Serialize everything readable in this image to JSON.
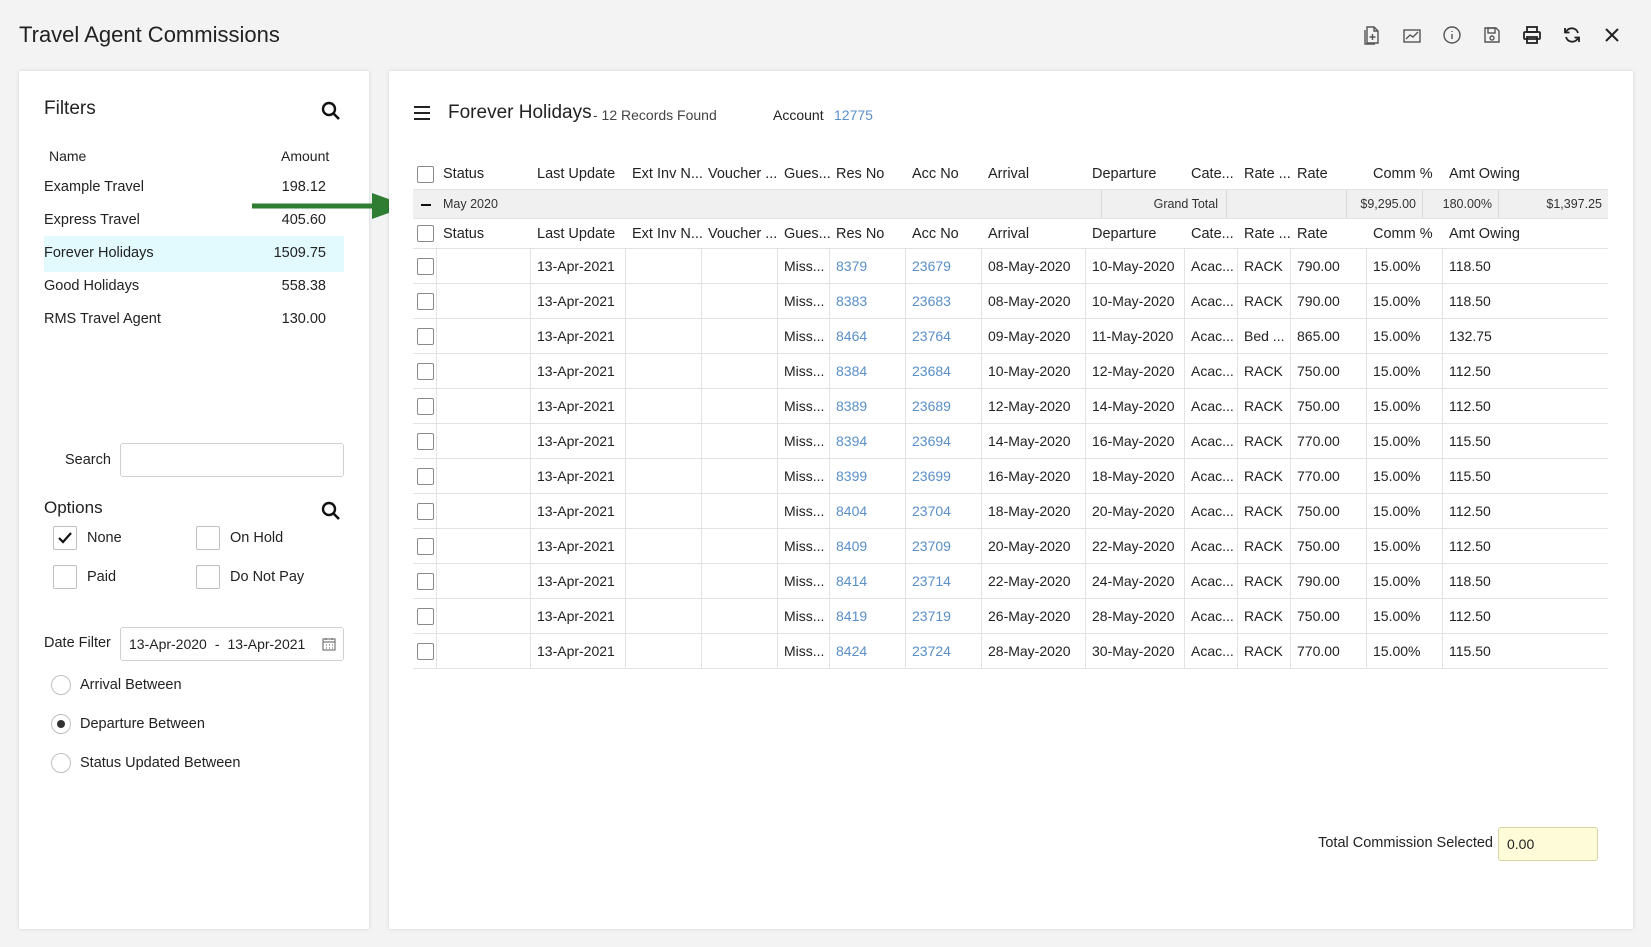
{
  "app": {
    "title": "Travel Agent Commissions"
  },
  "toolbar": {
    "icons": [
      "add-document-icon",
      "edit-chart-icon",
      "info-icon",
      "save-icon",
      "print-icon",
      "refresh-icon",
      "close-icon"
    ]
  },
  "filters": {
    "heading": "Filters",
    "col_name": "Name",
    "col_amount": "Amount",
    "agents": [
      {
        "name": "Example Travel",
        "amount": "198.12",
        "selected": false
      },
      {
        "name": "Express Travel",
        "amount": "405.60",
        "selected": false
      },
      {
        "name": "Forever Holidays",
        "amount": "1509.75",
        "selected": true
      },
      {
        "name": "Good Holidays",
        "amount": "558.38",
        "selected": false
      },
      {
        "name": "RMS Travel Agent",
        "amount": "130.00",
        "selected": false
      }
    ],
    "search_label": "Search",
    "search_value": "",
    "options_heading": "Options",
    "opt_none": "None",
    "opt_on_hold": "On Hold",
    "opt_paid": "Paid",
    "opt_do_not_pay": "Do Not Pay",
    "opt_none_checked": true,
    "date_filter_label": "Date Filter",
    "date_from": "13-Apr-2020",
    "date_sep": "-",
    "date_to": "13-Apr-2021",
    "radio_arrival": "Arrival Between",
    "radio_departure": "Departure Between",
    "radio_status": "Status Updated Between",
    "radio_selected": "departure"
  },
  "main": {
    "agency": "Forever Holidays",
    "records": "- 12 Records Found",
    "account_label": "Account",
    "account_value": "12775",
    "columns": [
      "Status",
      "Last Update",
      "Ext Inv N...",
      "Voucher ...",
      "Gues...",
      "Res No",
      "Acc No",
      "Arrival",
      "Departure",
      "Cate...",
      "Rate ...",
      "Rate",
      "Comm %",
      "Amt Owing"
    ],
    "group": {
      "label": "May 2020",
      "total_label": "Grand Total",
      "rate_total": "$9,295.00",
      "comm_total": "180.00%",
      "owing_total": "$1,397.25"
    },
    "rows": [
      {
        "status": "",
        "last_update": "13-Apr-2021",
        "ext_inv": "",
        "voucher": "",
        "guest": "Miss...",
        "res_no": "8379",
        "acc_no": "23679",
        "arrival": "08-May-2020",
        "departure": "10-May-2020",
        "category": "Acac...",
        "rate_type": "RACK",
        "rate": "790.00",
        "comm": "15.00%",
        "owing": "118.50"
      },
      {
        "status": "",
        "last_update": "13-Apr-2021",
        "ext_inv": "",
        "voucher": "",
        "guest": "Miss...",
        "res_no": "8383",
        "acc_no": "23683",
        "arrival": "08-May-2020",
        "departure": "10-May-2020",
        "category": "Acac...",
        "rate_type": "RACK",
        "rate": "790.00",
        "comm": "15.00%",
        "owing": "118.50"
      },
      {
        "status": "",
        "last_update": "13-Apr-2021",
        "ext_inv": "",
        "voucher": "",
        "guest": "Miss...",
        "res_no": "8464",
        "acc_no": "23764",
        "arrival": "09-May-2020",
        "departure": "11-May-2020",
        "category": "Acac...",
        "rate_type": "Bed ...",
        "rate": "865.00",
        "comm": "15.00%",
        "owing": "132.75"
      },
      {
        "status": "",
        "last_update": "13-Apr-2021",
        "ext_inv": "",
        "voucher": "",
        "guest": "Miss...",
        "res_no": "8384",
        "acc_no": "23684",
        "arrival": "10-May-2020",
        "departure": "12-May-2020",
        "category": "Acac...",
        "rate_type": "RACK",
        "rate": "750.00",
        "comm": "15.00%",
        "owing": "112.50"
      },
      {
        "status": "",
        "last_update": "13-Apr-2021",
        "ext_inv": "",
        "voucher": "",
        "guest": "Miss...",
        "res_no": "8389",
        "acc_no": "23689",
        "arrival": "12-May-2020",
        "departure": "14-May-2020",
        "category": "Acac...",
        "rate_type": "RACK",
        "rate": "750.00",
        "comm": "15.00%",
        "owing": "112.50"
      },
      {
        "status": "",
        "last_update": "13-Apr-2021",
        "ext_inv": "",
        "voucher": "",
        "guest": "Miss...",
        "res_no": "8394",
        "acc_no": "23694",
        "arrival": "14-May-2020",
        "departure": "16-May-2020",
        "category": "Acac...",
        "rate_type": "RACK",
        "rate": "770.00",
        "comm": "15.00%",
        "owing": "115.50"
      },
      {
        "status": "",
        "last_update": "13-Apr-2021",
        "ext_inv": "",
        "voucher": "",
        "guest": "Miss...",
        "res_no": "8399",
        "acc_no": "23699",
        "arrival": "16-May-2020",
        "departure": "18-May-2020",
        "category": "Acac...",
        "rate_type": "RACK",
        "rate": "770.00",
        "comm": "15.00%",
        "owing": "115.50"
      },
      {
        "status": "",
        "last_update": "13-Apr-2021",
        "ext_inv": "",
        "voucher": "",
        "guest": "Miss...",
        "res_no": "8404",
        "acc_no": "23704",
        "arrival": "18-May-2020",
        "departure": "20-May-2020",
        "category": "Acac...",
        "rate_type": "RACK",
        "rate": "750.00",
        "comm": "15.00%",
        "owing": "112.50"
      },
      {
        "status": "",
        "last_update": "13-Apr-2021",
        "ext_inv": "",
        "voucher": "",
        "guest": "Miss...",
        "res_no": "8409",
        "acc_no": "23709",
        "arrival": "20-May-2020",
        "departure": "22-May-2020",
        "category": "Acac...",
        "rate_type": "RACK",
        "rate": "750.00",
        "comm": "15.00%",
        "owing": "112.50"
      },
      {
        "status": "",
        "last_update": "13-Apr-2021",
        "ext_inv": "",
        "voucher": "",
        "guest": "Miss...",
        "res_no": "8414",
        "acc_no": "23714",
        "arrival": "22-May-2020",
        "departure": "24-May-2020",
        "category": "Acac...",
        "rate_type": "RACK",
        "rate": "790.00",
        "comm": "15.00%",
        "owing": "118.50"
      },
      {
        "status": "",
        "last_update": "13-Apr-2021",
        "ext_inv": "",
        "voucher": "",
        "guest": "Miss...",
        "res_no": "8419",
        "acc_no": "23719",
        "arrival": "26-May-2020",
        "departure": "28-May-2020",
        "category": "Acac...",
        "rate_type": "RACK",
        "rate": "750.00",
        "comm": "15.00%",
        "owing": "112.50"
      },
      {
        "status": "",
        "last_update": "13-Apr-2021",
        "ext_inv": "",
        "voucher": "",
        "guest": "Miss...",
        "res_no": "8424",
        "acc_no": "23724",
        "arrival": "28-May-2020",
        "departure": "30-May-2020",
        "category": "Acac...",
        "rate_type": "RACK",
        "rate": "770.00",
        "comm": "15.00%",
        "owing": "115.50"
      }
    ],
    "total_commission_label": "Total Commission Selected",
    "total_commission_value": "0.00"
  },
  "colors": {
    "link": "#5a8fc8",
    "selected_row": "#e2f9fd",
    "arrow": "#2e7d32",
    "total_field_bg": "#fdfbd8"
  }
}
